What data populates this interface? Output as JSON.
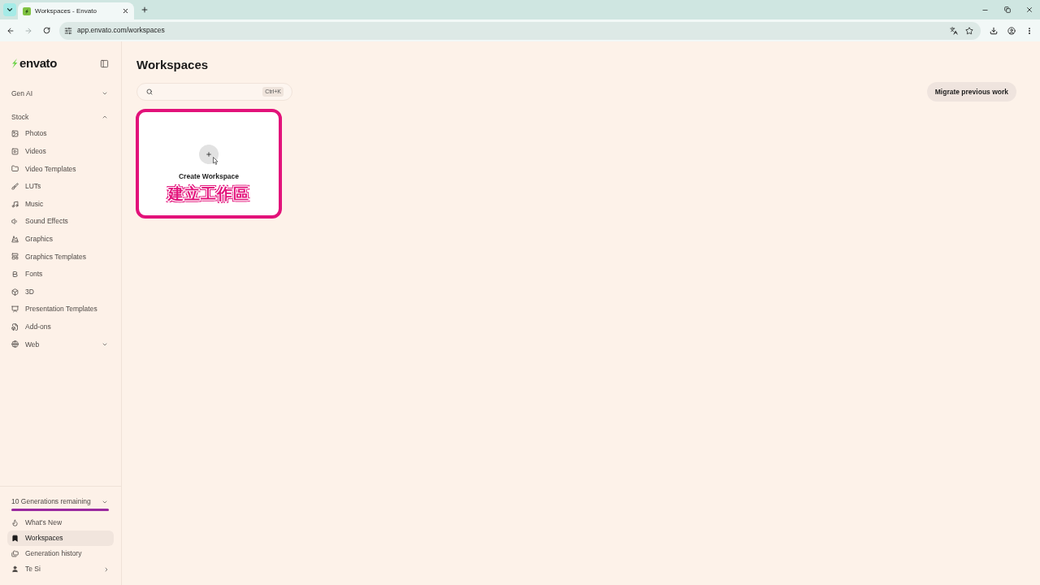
{
  "browser": {
    "tabs": [
      {
        "title": "Workspaces - Envato",
        "selected": true
      }
    ],
    "address": "app.envato.com/workspaces"
  },
  "sidebar": {
    "logo": "envato",
    "sections": [
      {
        "label": "Gen AI",
        "expanded": false
      },
      {
        "label": "Stock",
        "expanded": true,
        "items": [
          {
            "label": "Photos"
          },
          {
            "label": "Videos"
          },
          {
            "label": "Video Templates"
          },
          {
            "label": "LUTs"
          },
          {
            "label": "Music"
          },
          {
            "label": "Sound Effects"
          },
          {
            "label": "Graphics"
          },
          {
            "label": "Graphics Templates"
          },
          {
            "label": "Fonts"
          },
          {
            "label": "3D"
          },
          {
            "label": "Presentation Templates"
          },
          {
            "label": "Add-ons"
          },
          {
            "label": "Web",
            "expanded": false
          }
        ]
      }
    ],
    "generations": {
      "label": "10 Generations remaining",
      "level": 1,
      "expanded": false
    },
    "nav": [
      {
        "label": "What's New",
        "kind": "link",
        "selected": false
      },
      {
        "label": "Workspaces",
        "kind": "link",
        "selected": true
      },
      {
        "label": "Generation history",
        "kind": "link",
        "selected": false
      },
      {
        "label": "Te Si",
        "kind": "account",
        "selected": false
      }
    ]
  },
  "main": {
    "title": "Workspaces",
    "search": {
      "shortcut": "Ctrl+K"
    },
    "migrate_button": "Migrate previous work",
    "cards": [
      {
        "kind": "create",
        "label": "Create Workspace",
        "annotation": "建立工作區"
      }
    ]
  }
}
